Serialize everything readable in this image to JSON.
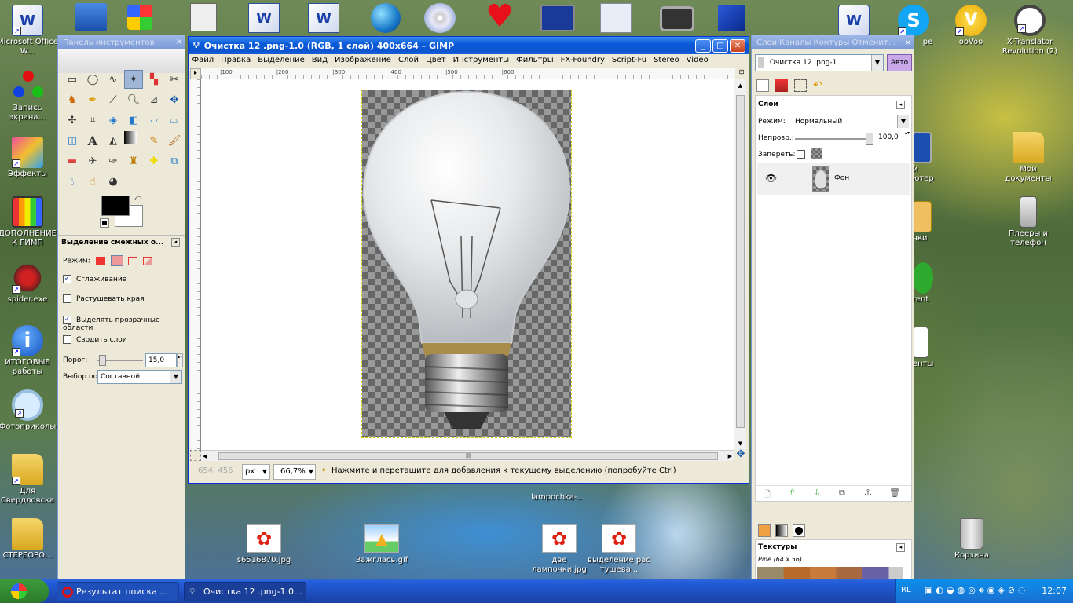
{
  "desktop": {
    "left_icons": [
      {
        "label": "Microsoft Office W..."
      },
      {
        "label": "Запись экрана..."
      },
      {
        "label": "Эффекты"
      },
      {
        "label": "ДОПОЛНЕНИЕ К ГИМП"
      },
      {
        "label": "spider.exe"
      },
      {
        "label": "ИТОГОВЫЕ работы"
      },
      {
        "label": "Фотоприколы"
      },
      {
        "label": "Для Свердловска"
      },
      {
        "label": "СТЕРЕОРО..."
      }
    ],
    "right_icons": [
      {
        "label": "pe"
      },
      {
        "label": "ooVoo"
      },
      {
        "label": "X-Translator Revolution (2)"
      },
      {
        "label": "Мои документы"
      },
      {
        "label": "Плееры и телефон"
      },
      {
        "label": "Корзина"
      },
      {
        "label": "й ютер"
      },
      {
        "label": "чки"
      },
      {
        "label": "rent"
      },
      {
        "label": "енты"
      }
    ],
    "bottom_icons": [
      {
        "label": "s6516870.jpg"
      },
      {
        "label": "Зажглась.gif"
      },
      {
        "label": "две лампочки.jpg"
      },
      {
        "label": "выделение рас тушева..."
      },
      {
        "label": "lampochka-..."
      }
    ]
  },
  "toolbox": {
    "title": "Панель инструментов",
    "section_title": "Выделение смежных о...",
    "mode_label": "Режим:",
    "options": [
      {
        "label": "Сглаживание",
        "checked": "✓"
      },
      {
        "label": "Растушевать края",
        "checked": ""
      },
      {
        "label": "Выделять прозрачные области",
        "checked": "✓"
      },
      {
        "label": "Сводить слои",
        "checked": ""
      }
    ],
    "threshold_label": "Порог:",
    "threshold_value": "15,0",
    "select_by_label": "Выбор по:",
    "select_by_value": "Составной"
  },
  "gimp_window": {
    "title": "Очистка 12 .png-1.0 (RGB, 1 слой) 400x664 – GIMP",
    "menu": [
      "Файл",
      "Правка",
      "Выделение",
      "Вид",
      "Изображение",
      "Слой",
      "Цвет",
      "Инструменты",
      "Фильтры",
      "FX-Foundry",
      "Script-Fu",
      "Stereo",
      "Video"
    ],
    "ruler_marks": [
      "|100",
      "|200",
      "|300",
      "|400",
      "|500",
      "|600"
    ],
    "coords": "654, 456",
    "unit": "px",
    "zoom": "66,7%",
    "status": "Нажмите и перетащите для добавления к текущему выделению (попробуйте Ctrl)"
  },
  "layers_panel": {
    "tabs": "Слои  Каналы  Контуры  Отменит...",
    "image_select": "Очистка 12 .png-1",
    "auto_button": "Авто",
    "section_title": "Слои",
    "mode_label": "Режим:",
    "mode_value": "Нормальный",
    "opacity_label": "Непрозр.:",
    "opacity_value": "100,0",
    "lock_label": "Запереть:",
    "layer_name": "Фон",
    "textures_title": "Текстуры",
    "texture_name": "Pine (64 x 56)"
  },
  "taskbar": {
    "tasks": [
      {
        "label": "Результат поиска ..."
      },
      {
        "label": "Очистка 12 .png-1.0..."
      }
    ],
    "lang": "RL",
    "clock": "12:07"
  }
}
